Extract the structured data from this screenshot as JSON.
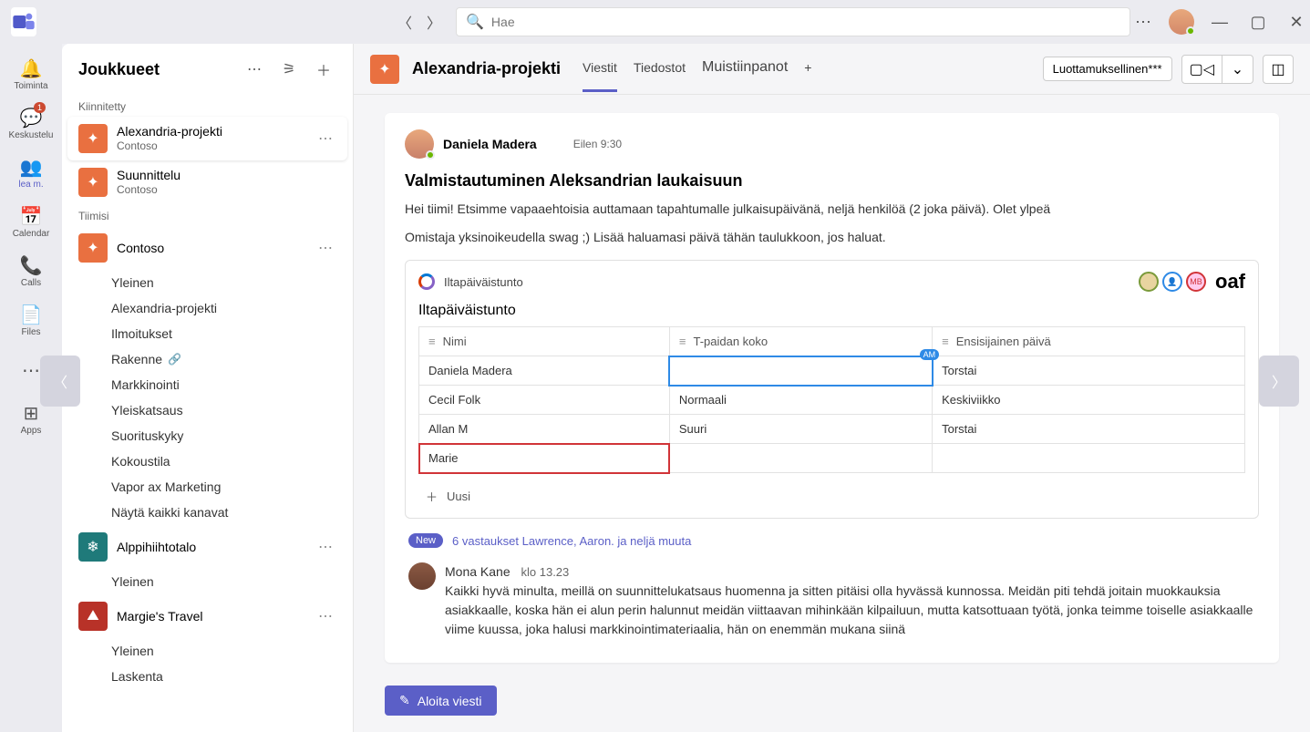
{
  "search": {
    "placeholder": "Hae"
  },
  "rail": {
    "activity": "Toiminta",
    "chat": "Keskustelu",
    "teams": "lea m.",
    "calendar": "Calendar",
    "calls": "Calls",
    "files": "Files",
    "apps": "Apps",
    "chat_badge": "1"
  },
  "sidebar": {
    "title": "Joukkueet",
    "section_pinned": "Kiinnitetty",
    "section_yours": "Tiimisi",
    "pinned": [
      {
        "name": "Alexandria-projekti",
        "sub": "Contoso"
      },
      {
        "name": "Suunnittelu",
        "sub": "Contoso"
      }
    ],
    "teams": [
      {
        "name": "Contoso",
        "channels": [
          "Yleinen",
          "Alexandria-projekti",
          "Ilmoitukset",
          "Rakenne",
          "Markkinointi",
          "Yleiskatsaus",
          "Suorituskyky",
          "Kokoustila",
          "Vapor ax Marketing",
          "Näytä kaikki kanavat"
        ]
      },
      {
        "name": "Alppihiihtotalo",
        "channels": [
          "Yleinen"
        ]
      },
      {
        "name": "Margie's Travel",
        "channels": [
          "Yleinen",
          "Laskenta"
        ]
      }
    ]
  },
  "header": {
    "channel": "Alexandria-projekti",
    "tabs": {
      "messages": "Viestit",
      "files": "Tiedostot",
      "notes": "Muistiinpanot",
      "add": "+"
    },
    "sensitivity": "Luottamuksellinen***"
  },
  "post": {
    "author": "Daniela Madera",
    "time": "Eilen 9:30",
    "title": "Valmistautuminen Aleksandrian laukaisuun",
    "body1": "Hei tiimi! Etsimme vapaaehtoisia auttamaan tapahtumalle julkaisupäivänä, neljä henkilöä (2 joka päivä). Olet ylpeä",
    "body2": "Omistaja yksinoikeudella swag      ;) Lisää haluamasi päivä tähän taulukkoon, jos haluat."
  },
  "loop": {
    "component_name": "Iltapäiväistunto",
    "title": "Iltapäiväistunto",
    "tag": "oaf",
    "columns": [
      "Nimi",
      "T-paidan koko",
      "Ensisijainen päivä"
    ],
    "rows": [
      {
        "name": "Daniela Madera",
        "size": "",
        "day": "Torstai"
      },
      {
        "name": "Cecil Folk",
        "size": "Normaali",
        "day": "Keskiviikko"
      },
      {
        "name": "Allan M",
        "size": "Suuri",
        "day": "Torstai"
      },
      {
        "name": "Marie",
        "size": "",
        "day": ""
      }
    ],
    "add_row": "Uusi",
    "cursor_am": "AM",
    "cursor_mb": "MB"
  },
  "replies": {
    "badge": "New",
    "text": "6 vastaukset Lawrence, Aaron. ja neljä muuta"
  },
  "reply": {
    "author": "Mona Kane",
    "time": "klo 13.23",
    "body": "Kaikki hyvä minulta, meillä on suunnittelukatsaus huomenna ja sitten pitäisi olla hyvässä kunnossa. Meidän piti tehdä joitain muokkauksia asiakkaalle, koska hän ei alun perin halunnut meidän viittaavan mihinkään kilpailuun, mutta katsottuaan työtä, jonka teimme toiselle asiakkaalle viime kuussa, joka halusi markkinointimateriaalia, hän on enemmän mukana siinä"
  },
  "compose": {
    "label": "Aloita viesti"
  }
}
